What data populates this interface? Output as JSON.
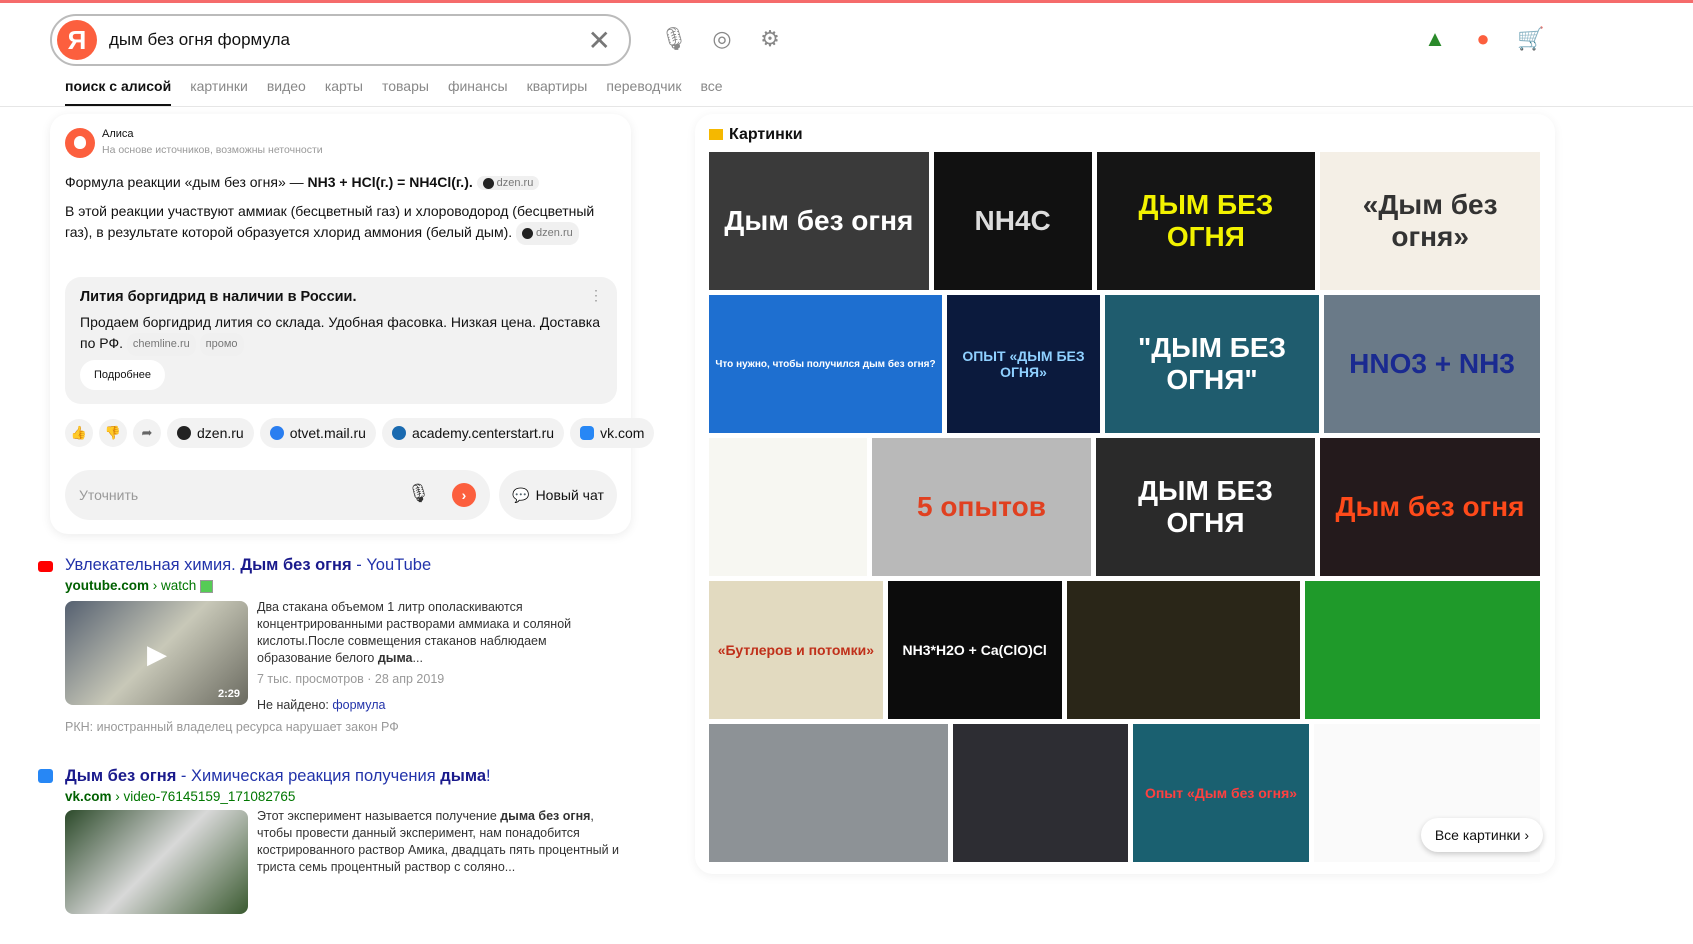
{
  "header": {
    "logo": "Я",
    "query": "дым без огня формула",
    "clear_icon": "close-icon",
    "icons": [
      "microphone-icon",
      "camera-icon",
      "filters-icon",
      "tree-icon",
      "alice-icon",
      "cart-icon"
    ]
  },
  "tabs": [
    "поиск с алисой",
    "картинки",
    "видео",
    "карты",
    "товары",
    "финансы",
    "квартиры",
    "переводчик",
    "все"
  ],
  "alice": {
    "name": "Алиса",
    "subtitle": "На основе источников, возможны неточности",
    "answer_prefix": "Формула реакции «дым без огня» — ",
    "answer_bold": "NH3 + HCl(г.) = NH4Cl(г.).",
    "answer_source": "dzen.ru",
    "paragraph": "В этой реакции участвуют аммиак (бесцветный газ) и хлороводород (бесцветный газ), в результате которой образуется хлорид аммония (белый дым).",
    "paragraph_source": "dzen.ru",
    "ad": {
      "title": "Лития боргидрид в наличии в России.",
      "text": "Продаем боргидрид лития со склада. Удобная фасовка. Низкая цена. Доставка по РФ.",
      "source": "chemline.ru",
      "badge": "промо",
      "button": "Подробнее"
    },
    "sources": [
      "dzen.ru",
      "otvet.mail.ru",
      "academy.centerstart.ru",
      "vk.com"
    ],
    "refine_placeholder": "Уточнить",
    "new_chat": "Новый чат"
  },
  "results": [
    {
      "title_pre": "Увлекательная химия. ",
      "title_bold": "Дым без огня",
      "title_post": " - YouTube",
      "domain": "youtube.com",
      "path": " › watch",
      "snippet": "Два стакана объемом 1 литр ополаскиваются концентрированными растворами аммиака и соляной кислоты.После совмещения стаканов наблюдаем образование белого ",
      "snippet_bold": "дыма",
      "snippet_end": "...",
      "duration": "2:29",
      "meta": "7 тыс. просмотров · 28 апр 2019",
      "not_found_label": "Не найдено: ",
      "not_found_word": "формула",
      "warning": "РКН: иностранный владелец ресурса нарушает закон РФ"
    },
    {
      "title_bold": "Дым без огня",
      "title_post": " - Химическая реакция получения ",
      "title_bold2": "дыма",
      "title_end": "!",
      "domain": "vk.com",
      "path": " › video-76145159_171082765",
      "snippet_pre": "Этот эксперимент называется получение ",
      "snippet_bold": "дыма без огня",
      "snippet_post": ", чтобы провести данный эксперимент, нам понадобится кострированного раствор Амика, двадцать пять процентный и триста семь процентный раствор с соляно..."
    }
  ],
  "images": {
    "title": "Картинки",
    "all_button": "Все картинки",
    "rows": [
      [
        {
          "w": 220,
          "bg": "#3a3a3a",
          "fg": "#fff",
          "t": "Дым без огня"
        },
        {
          "w": 158,
          "bg": "#111",
          "fg": "#ddd",
          "t": "NH4C"
        },
        {
          "w": 219,
          "bg": "#151515",
          "fg": "#f2f200",
          "t": "ДЫМ БЕЗ ОГНЯ"
        },
        {
          "w": 220,
          "bg": "#f4efe6",
          "fg": "#333",
          "t": "«Дым без огня»"
        }
      ],
      [
        {
          "w": 233,
          "bg": "#1e6fd0",
          "fg": "#fff",
          "t": "Что нужно, чтобы получился дым без огня?"
        },
        {
          "w": 153,
          "bg": "#0b1a3d",
          "fg": "#8fd0ff",
          "t": "ОПЫТ «ДЫМ БЕЗ ОГНЯ»"
        },
        {
          "w": 214,
          "bg": "#1f5c6e",
          "fg": "#fff",
          "t": "\"ДЫМ БЕЗ ОГНЯ\""
        },
        {
          "w": 216,
          "bg": "#6a7a88",
          "fg": "#1a2a90",
          "t": "HNO3 + NH3"
        }
      ],
      [
        {
          "w": 158,
          "bg": "#f7f7f2",
          "fg": "#333",
          "t": ""
        },
        {
          "w": 219,
          "bg": "#b9b9b9",
          "fg": "#e04020",
          "t": "5 опытов"
        },
        {
          "w": 219,
          "bg": "#2a2a2a",
          "fg": "#fff",
          "t": "ДЫМ БЕЗ ОГНЯ"
        },
        {
          "w": 220,
          "bg": "#241a1c",
          "fg": "#ff4a1a",
          "t": "Дым без огня"
        }
      ],
      [
        {
          "w": 174,
          "bg": "#e2dac0",
          "fg": "#c0301a",
          "t": "«Бутлеров и потомки»"
        },
        {
          "w": 174,
          "bg": "#0c0c0c",
          "fg": "#fff",
          "t": "NH3*H2O + Ca(ClO)Cl"
        },
        {
          "w": 234,
          "bg": "#2a2618",
          "fg": "#fff",
          "t": ""
        },
        {
          "w": 235,
          "bg": "#1f9a2a",
          "fg": "#fff",
          "t": ""
        }
      ],
      [
        {
          "w": 239,
          "bg": "#8d9296",
          "fg": "#fff",
          "t": ""
        },
        {
          "w": 175,
          "bg": "#2d2d33",
          "fg": "#fff",
          "t": ""
        },
        {
          "w": 176,
          "bg": "#1a6070",
          "fg": "#ff4040",
          "t": "Опыт «Дым без огня»"
        },
        {
          "w": 226,
          "bg": "#fafafa",
          "fg": "#333",
          "t": ""
        }
      ]
    ]
  },
  "colors": {
    "accent": "#fc5f3e",
    "link": "#2233aa",
    "url": "#007700"
  }
}
